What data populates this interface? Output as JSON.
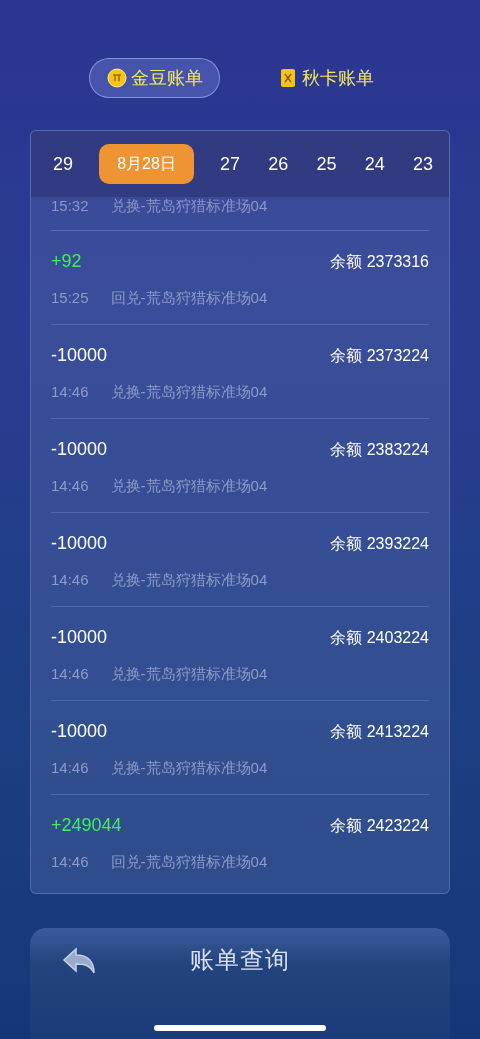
{
  "tabs": [
    {
      "label": "金豆账单",
      "selected": true,
      "kind": "coin"
    },
    {
      "label": "秋卡账单",
      "selected": false,
      "kind": "card"
    }
  ],
  "dates": [
    {
      "label": "29",
      "selected": false
    },
    {
      "label": "8月28日",
      "selected": true
    },
    {
      "label": "27",
      "selected": false
    },
    {
      "label": "26",
      "selected": false
    },
    {
      "label": "25",
      "selected": false
    },
    {
      "label": "24",
      "selected": false
    },
    {
      "label": "23",
      "selected": false
    }
  ],
  "partial_record": {
    "time": "15:32",
    "desc": "兑换-荒岛狩猎标准场04"
  },
  "records": [
    {
      "kind": "credit",
      "amount": "+92",
      "balance": "余额 2373316",
      "time": "15:25",
      "desc": "回兑-荒岛狩猎标准场04"
    },
    {
      "kind": "debit",
      "amount": "-10000",
      "balance": "余额 2373224",
      "time": "14:46",
      "desc": "兑换-荒岛狩猎标准场04"
    },
    {
      "kind": "debit",
      "amount": "-10000",
      "balance": "余额 2383224",
      "time": "14:46",
      "desc": "兑换-荒岛狩猎标准场04"
    },
    {
      "kind": "debit",
      "amount": "-10000",
      "balance": "余额 2393224",
      "time": "14:46",
      "desc": "兑换-荒岛狩猎标准场04"
    },
    {
      "kind": "debit",
      "amount": "-10000",
      "balance": "余额 2403224",
      "time": "14:46",
      "desc": "兑换-荒岛狩猎标准场04"
    },
    {
      "kind": "debit",
      "amount": "-10000",
      "balance": "余额 2413224",
      "time": "14:46",
      "desc": "兑换-荒岛狩猎标准场04"
    },
    {
      "kind": "credit",
      "amount": "+249044",
      "balance": "余额 2423224",
      "time": "14:46",
      "desc": "回兑-荒岛狩猎标准场04"
    }
  ],
  "bottom_bar": {
    "title": "账单查询"
  }
}
